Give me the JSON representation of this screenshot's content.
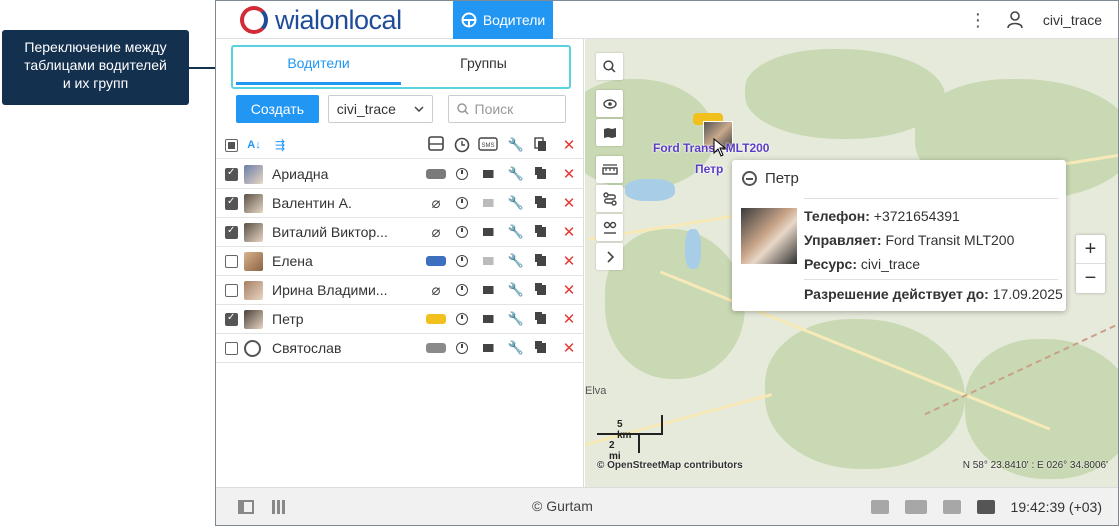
{
  "callout": {
    "text_line1": "Переключение между",
    "text_line2": "таблицами водителей",
    "text_line3": "и их групп"
  },
  "header": {
    "logo_text": "wialonlocal",
    "nav_active_label": "Водители",
    "username": "civi_trace"
  },
  "tabs": [
    {
      "label": "Водители",
      "active": true
    },
    {
      "label": "Группы",
      "active": false
    }
  ],
  "toolbar": {
    "create_label": "Создать",
    "resource_value": "civi_trace",
    "search_placeholder": "Поиск"
  },
  "table": {
    "column_icons": [
      "select-all-icon",
      "sort-az-icon",
      "hierarchy-icon",
      "bus-icon",
      "clock-icon",
      "sms-icon",
      "wrench-icon",
      "copy-icon",
      "delete-icon"
    ],
    "rows": [
      {
        "checked": true,
        "name": "Ариадна",
        "vehicle_color": "#7a7a7a",
        "mail_active": true
      },
      {
        "checked": true,
        "name": "Валентин А.",
        "vehicle_color": "none",
        "mail_active": false
      },
      {
        "checked": true,
        "name": "Виталий Виктор...",
        "vehicle_color": "none",
        "mail_active": true
      },
      {
        "checked": false,
        "name": "Елена",
        "vehicle_color": "#3d6fbf",
        "mail_active": false
      },
      {
        "checked": false,
        "name": "Ирина Владими...",
        "vehicle_color": "none",
        "mail_active": true
      },
      {
        "checked": true,
        "name": "Петр",
        "vehicle_color": "#f2c01c",
        "mail_active": true
      },
      {
        "checked": false,
        "name": "Святослав",
        "vehicle_color": "#8a8a8a",
        "mail_active": true
      }
    ]
  },
  "map": {
    "unit_label": "Ford Transit MLT200",
    "driver_label": "Петр",
    "city_label": "Elva",
    "scale_km": "5 km",
    "scale_mi": "2 mi",
    "attribution": "© OpenStreetMap contributors",
    "coordinates": "N 58° 23.8410' : E 026° 34.8006'",
    "zoom_in": "+",
    "zoom_out": "−"
  },
  "popup": {
    "title": "Петр",
    "phone_label": "Телефон:",
    "phone_value": "+3721654391",
    "controls_label": "Управляет:",
    "controls_value": "Ford Transit MLT200",
    "resource_label": "Ресурс:",
    "resource_value": "civi_trace",
    "permit_label": "Разрешение действует до:",
    "permit_value": "17.09.2025"
  },
  "footer": {
    "copyright": "© Gurtam",
    "time": "19:42:39 (+03)"
  },
  "colors": {
    "accent": "#2196f3",
    "callout_bg": "#14304f",
    "highlight": "#5ad2e0",
    "delete": "#e53935"
  }
}
